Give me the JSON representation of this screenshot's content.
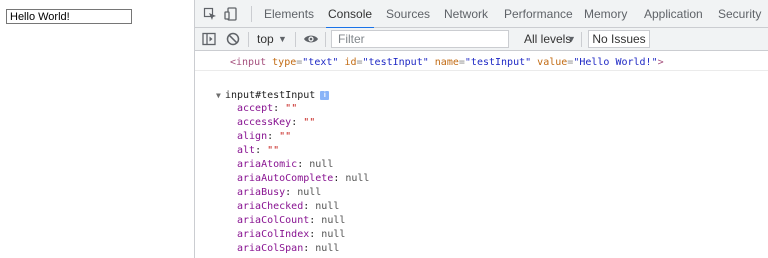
{
  "page": {
    "input_value": "Hello World!"
  },
  "devtools": {
    "tabs": [
      "Elements",
      "Console",
      "Sources",
      "Network",
      "Performance",
      "Memory",
      "Application",
      "Security"
    ],
    "active_tab": "Console",
    "toolbar": {
      "context": "top",
      "filter_placeholder": "Filter",
      "levels": "All levels",
      "issues": "No Issues"
    },
    "console": {
      "html_tag_open": "<input",
      "attrs": [
        {
          "name": "type",
          "value": "\"text\""
        },
        {
          "name": "id",
          "value": "\"testInput\""
        },
        {
          "name": "name",
          "value": "\"testInput\""
        },
        {
          "name": "value",
          "value": "\"Hello World!\""
        }
      ],
      "html_tag_close": ">",
      "object_label": "input#testInput",
      "info_badge": "i",
      "properties": [
        {
          "key": "accept",
          "value": "\"\"",
          "kind": "str"
        },
        {
          "key": "accessKey",
          "value": "\"\"",
          "kind": "str"
        },
        {
          "key": "align",
          "value": "\"\"",
          "kind": "str"
        },
        {
          "key": "alt",
          "value": "\"\"",
          "kind": "str"
        },
        {
          "key": "ariaAtomic",
          "value": "null",
          "kind": "null"
        },
        {
          "key": "ariaAutoComplete",
          "value": "null",
          "kind": "null"
        },
        {
          "key": "ariaBusy",
          "value": "null",
          "kind": "null"
        },
        {
          "key": "ariaChecked",
          "value": "null",
          "kind": "null"
        },
        {
          "key": "ariaColCount",
          "value": "null",
          "kind": "null"
        },
        {
          "key": "ariaColIndex",
          "value": "null",
          "kind": "null"
        },
        {
          "key": "ariaColSpan",
          "value": "null",
          "kind": "null"
        }
      ]
    }
  },
  "colors": {
    "accent": "#1a73e8",
    "tag": "#a5507d",
    "attr_name": "#c26b13",
    "attr_value": "#1f29c5",
    "prop_key": "#881391",
    "string": "#c41a16"
  },
  "icons": [
    "inspect-icon",
    "device-toolbar-icon",
    "sidebar-toggle-icon",
    "clear-console-icon",
    "eye-icon",
    "settings-icon",
    "expand-triangle-icon",
    "info-icon"
  ]
}
